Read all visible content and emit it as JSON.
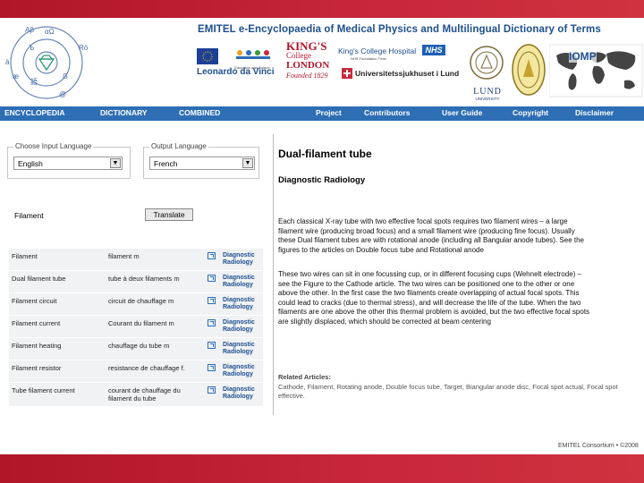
{
  "site": {
    "title": "EMITEL e-Encyclopaedia of Medical Physics and Multilingual Dictionary of Terms",
    "brand_color": "#1d4f8f",
    "nav_color": "#2d6eb4",
    "band_color": "#c8283a"
  },
  "emblem": {
    "glyphs": [
      "Aβ",
      "αΩ",
      "Ъ",
      "Rö",
      "ä",
      "ẞ",
      "æ",
      "語",
      "@"
    ]
  },
  "logos": {
    "leonardo": "Leonardo da Vinci",
    "education": "Education and Culture",
    "kings_line1": "KING'S",
    "kings_line2": "College",
    "kings_line3": "LONDON",
    "kings_line4": "Founded 1829",
    "kch": "King's College Hospital",
    "nhs": "NHS",
    "nhs_trust": "NHS Foundation Trust",
    "unisjukhus": "Universitetssjukhuset i Lund",
    "lund": "LUND",
    "lund_sub": "UNIVERSITY",
    "iomp": "IOMP"
  },
  "nav": {
    "items": [
      "ENCYCLOPEDIA",
      "DICTIONARY",
      "COMBINED",
      "Project",
      "Contributors",
      "User Guide",
      "Copyright",
      "Disclaimer"
    ]
  },
  "search": {
    "input_language_label": "Choose Input Language",
    "input_language_value": "English",
    "output_language_label": "Output Language",
    "output_language_value": "French",
    "term": "Filament",
    "translate_label": "Translate"
  },
  "results": {
    "rows": [
      {
        "term": "Filament",
        "translation": "filament m",
        "domain": "Diagnostic Radiology"
      },
      {
        "term": "Dual filament tube",
        "translation": "tube à deux filaments m",
        "domain": "Diagnostic Radiology"
      },
      {
        "term": "Filament circuit",
        "translation": "circuit de chauffage m",
        "domain": "Diagnostic Radiology"
      },
      {
        "term": "Filament current",
        "translation": "Courant du filament m",
        "domain": "Diagnostic Radiology"
      },
      {
        "term": "Filament heating",
        "translation": "chauffage du tube m",
        "domain": "Diagnostic Radiology"
      },
      {
        "term": "Filament resistor",
        "translation": "resistance de chauffage f.",
        "domain": "Diagnostic Radiology"
      },
      {
        "term": "Tube filament current",
        "translation": "courant de chauffage du filament du tube",
        "domain": "Diagnostic Radiology"
      }
    ]
  },
  "article": {
    "title": "Dual-filament tube",
    "domain": "Diagnostic Radiology",
    "para1": [
      "Each classical X-ray tube with two effective focal spots requires two filament wires – a large",
      "filament wire (producing broad focus) and a small filament wire (producing fine focus). Usually",
      "these Dual filament tubes are with rotational anode (including all Bangular anode tubes). See the",
      "figures to the articles on Double focus tube and Rotational anode"
    ],
    "para2": [
      "These two wires can sit in one focussing cup, or in different focusing cups (Wehnelt electrode) –",
      "see the Figure to the Cathode article. The two wires can be positioned one to the other or one",
      "above the other. In the first case the two filaments create overlapping of actual focal spots. This",
      "could lead to cracks (due to thermal stress), and will decrease the life of the tube. When the two",
      "filaments are one above the other this thermal problem is avoided, but the two effective focal spots",
      "are slightly displaced, which should be corrected at beam centering"
    ],
    "related_title": "Related Articles:",
    "related_lines": [
      "Cathode, Filament, Rotating anode, Double focus tube, Target, Biangular anode disc, Focal spot actual, Focal spot",
      "effective."
    ]
  },
  "footer": {
    "text": "EMITEL Consortium • ©2008"
  }
}
